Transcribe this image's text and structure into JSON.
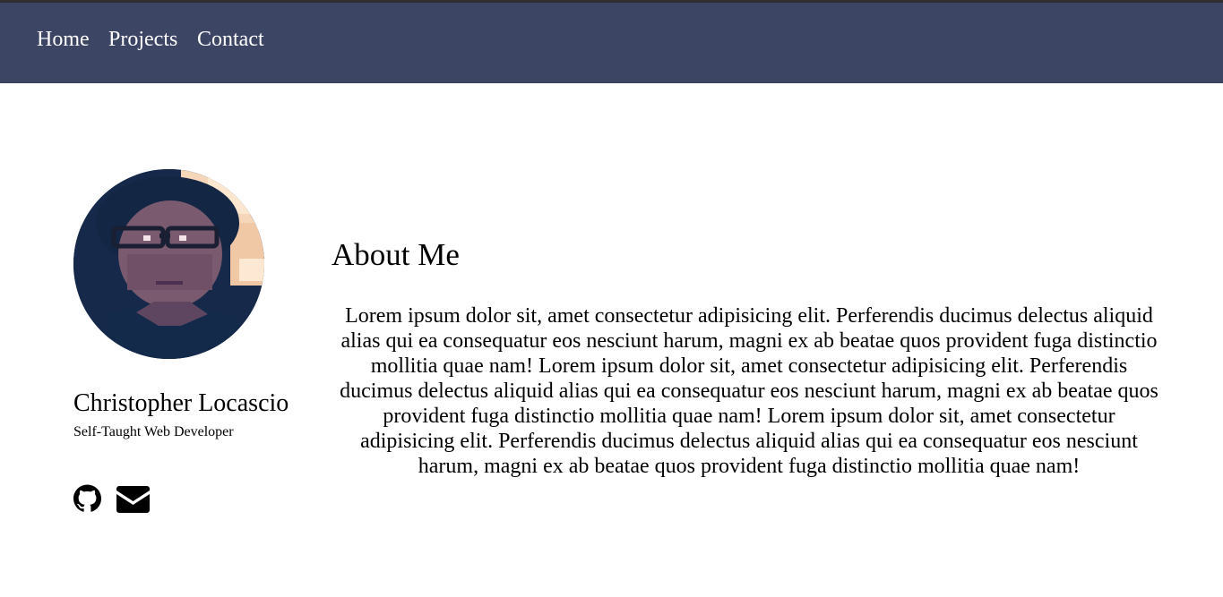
{
  "nav": {
    "items": [
      {
        "label": "Home"
      },
      {
        "label": "Projects"
      },
      {
        "label": "Contact"
      }
    ],
    "background_color": "#3d4565",
    "text_color": "#ffffff"
  },
  "profile": {
    "name": "Christopher Locascio",
    "role": "Self-Taught Web Developer",
    "avatar_icon": "profile-photo",
    "social": [
      {
        "icon": "github-icon"
      },
      {
        "icon": "envelope-icon"
      }
    ]
  },
  "about": {
    "heading": "About Me",
    "body": "Lorem ipsum dolor sit, amet consectetur adipisicing elit. Perferendis ducimus delectus aliquid alias qui ea consequatur eos nesciunt harum, magni ex ab beatae quos provident fuga distinctio mollitia quae nam! Lorem ipsum dolor sit, amet consectetur adipisicing elit. Perferendis ducimus delectus aliquid alias qui ea consequatur eos nesciunt harum, magni ex ab beatae quos provident fuga distinctio mollitia quae nam! Lorem ipsum dolor sit, amet consectetur adipisicing elit. Perferendis ducimus delectus aliquid alias qui ea consequatur eos nesciunt harum, magni ex ab beatae quos provident fuga distinctio mollitia quae nam!"
  }
}
